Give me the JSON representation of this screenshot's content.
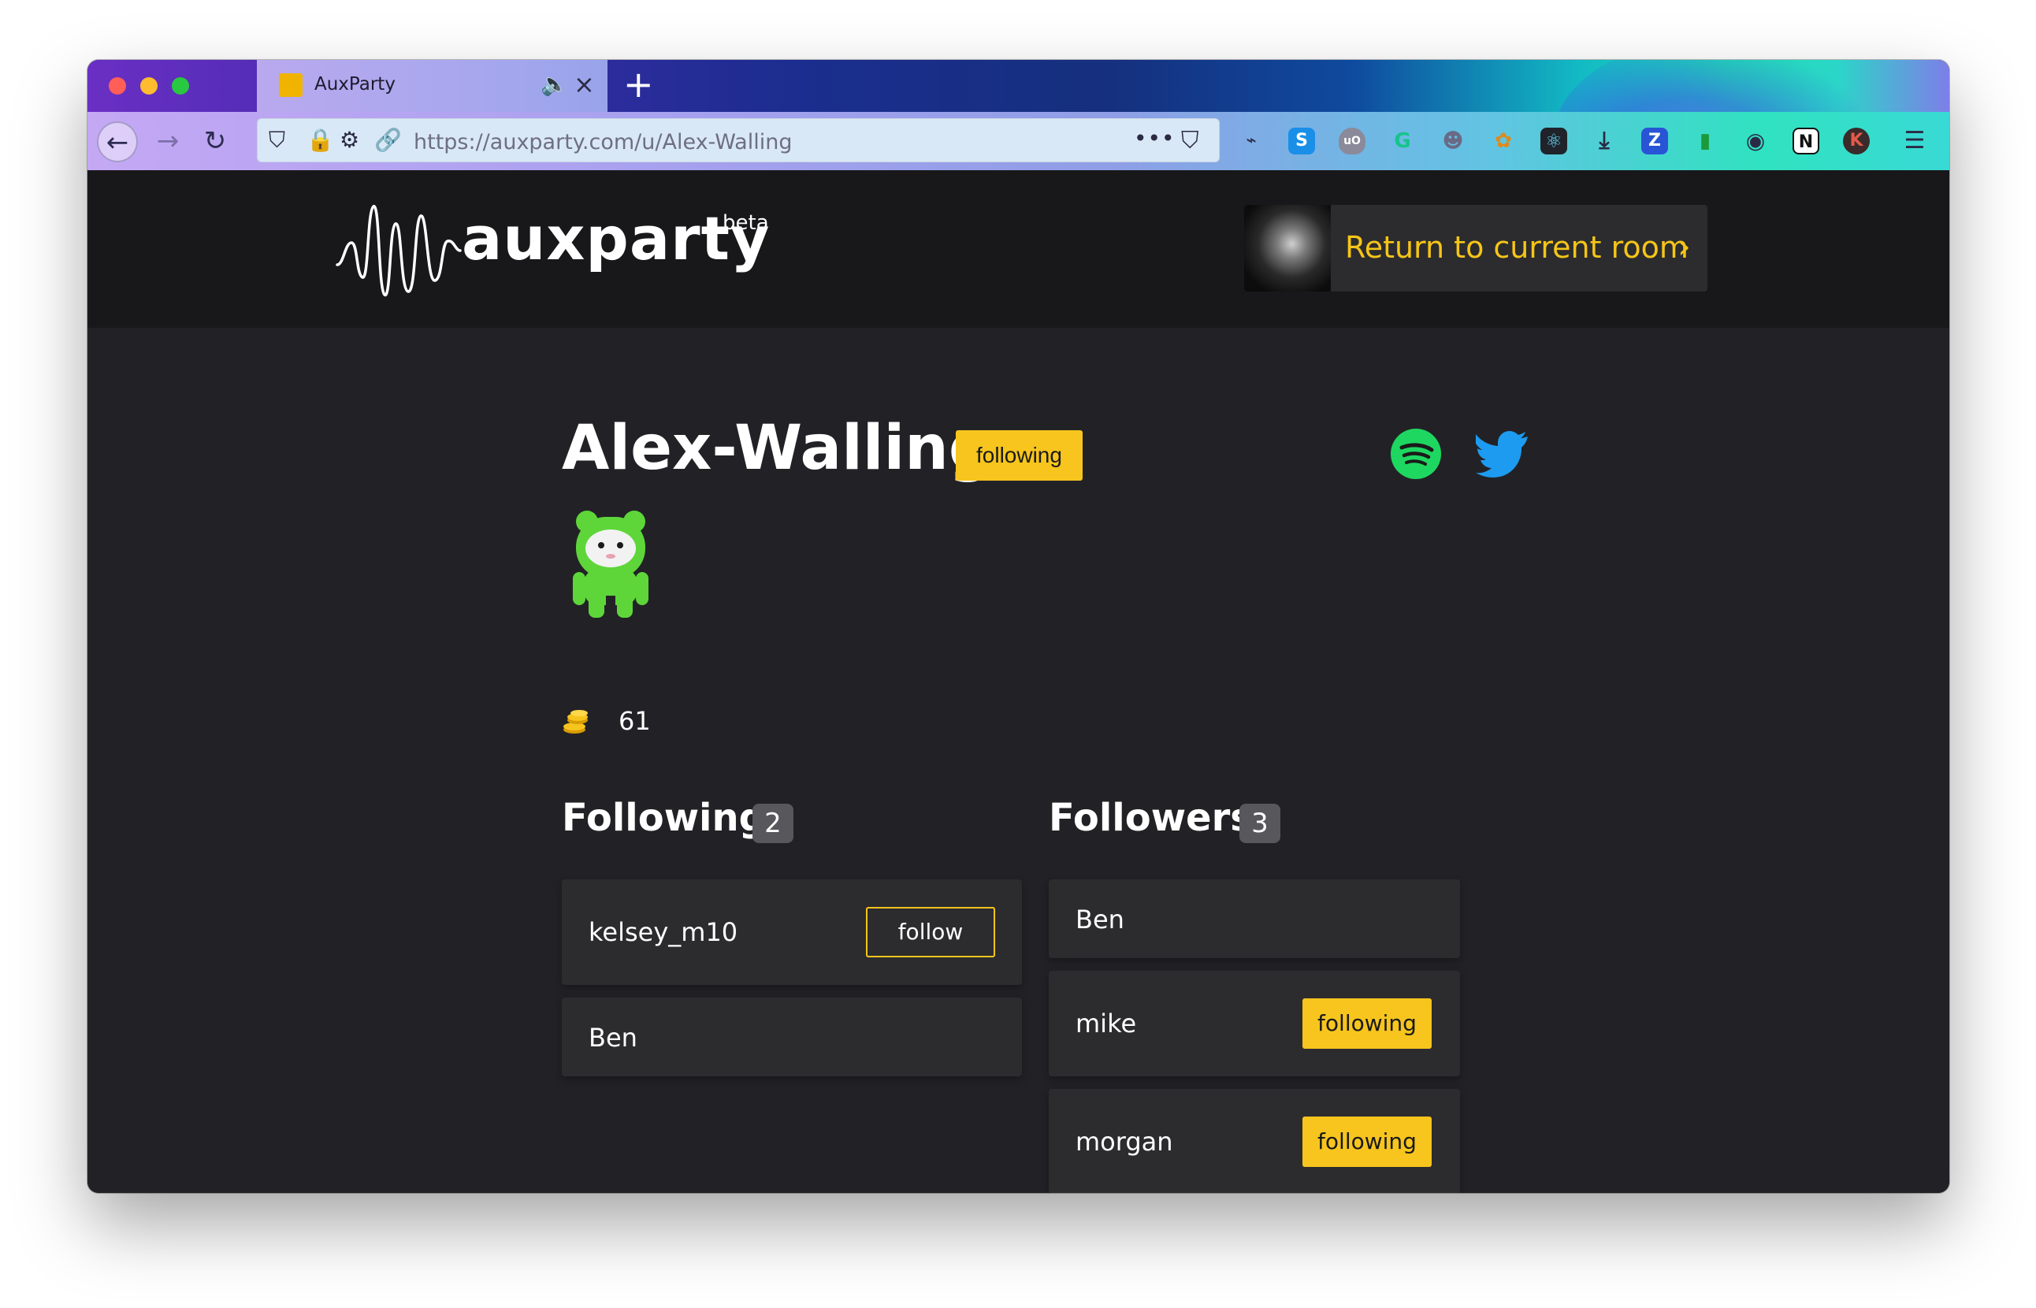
{
  "browser": {
    "tab_title": "AuxParty",
    "url_host": "https://auxparty.com",
    "url_path": "/u/Alex-Walling",
    "new_tab_label": "+",
    "url_more_label": "•••"
  },
  "header": {
    "logo_text": "auxparty",
    "beta_label": "beta",
    "return_label": "Return to current room",
    "return_chevron": "›"
  },
  "profile": {
    "username": "Alex-Walling",
    "follow_status": "following",
    "coins": "61"
  },
  "following": {
    "title": "Following",
    "count": "2",
    "items": [
      {
        "name": "kelsey_m10",
        "action": "follow"
      },
      {
        "name": "Ben"
      }
    ]
  },
  "followers": {
    "title": "Followers",
    "count": "3",
    "items": [
      {
        "name": "Ben"
      },
      {
        "name": "mike",
        "action": "following"
      },
      {
        "name": "morgan",
        "action": "following"
      }
    ]
  },
  "colors": {
    "accent": "#f7c51e",
    "page_bg": "#222226",
    "header_bg": "#18181a",
    "card_bg": "#2c2c2e",
    "spotify": "#1ed760",
    "twitter": "#1d9bf0",
    "avatar": "#5ed63a"
  }
}
